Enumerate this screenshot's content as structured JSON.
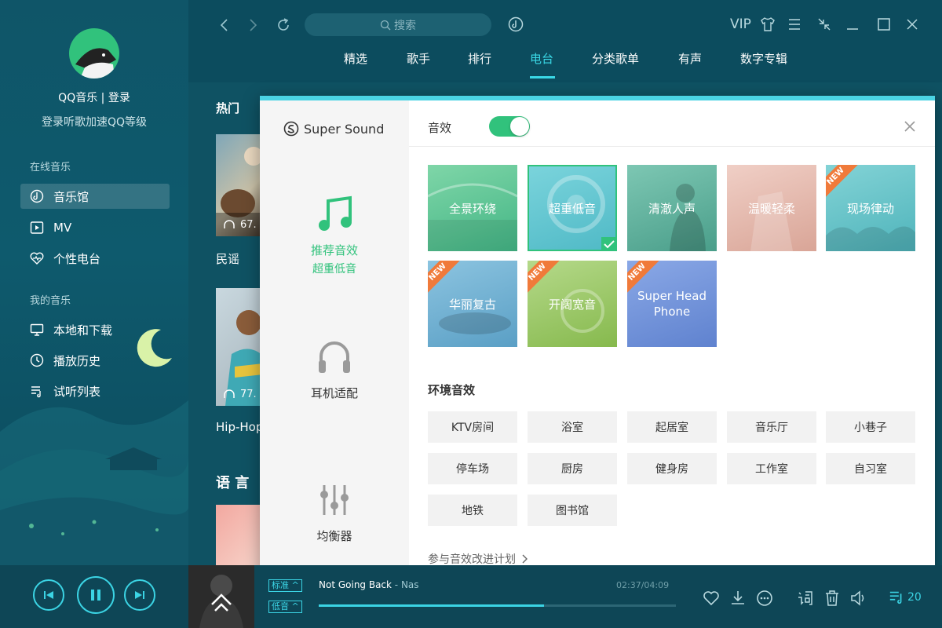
{
  "sidebar": {
    "login_text": "QQ音乐 | 登录",
    "login_hint": "登录听歌加速QQ等级",
    "online_section": "在线音乐",
    "online_items": [
      "音乐馆",
      "MV",
      "个性电台"
    ],
    "my_section": "我的音乐",
    "my_items": [
      "本地和下载",
      "播放历史",
      "试听列表"
    ]
  },
  "topbar": {
    "search_placeholder": "搜索",
    "vip_label": "VIP",
    "tabs": [
      "精选",
      "歌手",
      "排行",
      "电台",
      "分类歌单",
      "有声",
      "数字专辑"
    ],
    "active_tab": "电台"
  },
  "background": {
    "hot_label": "热门",
    "card1_count": "67.",
    "card1_title": "民谣",
    "card2_count": "77.",
    "card2_title": "Hip-Hop",
    "lang_label": "语 言"
  },
  "dialog": {
    "brand": "Super Sound",
    "effect_label": "音效",
    "effect_on": true,
    "side": {
      "recommend_title": "推荐音效",
      "recommend_sub": "超重低音",
      "headphone": "耳机适配",
      "equalizer": "均衡器"
    },
    "tiles": [
      {
        "label": "全景环绕",
        "color": "#4cbd8a",
        "new": false,
        "selected": false
      },
      {
        "label": "超重低音",
        "color": "#58c4cf",
        "new": false,
        "selected": true
      },
      {
        "label": "清澈人声",
        "color": "#5fb49f",
        "new": false,
        "selected": false
      },
      {
        "label": "温暖轻柔",
        "color": "#e7b8ad",
        "new": false,
        "selected": false
      },
      {
        "label": "现场律动",
        "color": "#5ac2c7",
        "new": true,
        "selected": false
      },
      {
        "label": "华丽复古",
        "color": "#6aaed0",
        "new": true,
        "selected": false
      },
      {
        "label": "开阔宽音",
        "color": "#97c45a",
        "new": true,
        "selected": false
      },
      {
        "label": "Super Head Phone",
        "color": "#6b8fd6",
        "new": true,
        "selected": false
      }
    ],
    "new_badge": "NEW",
    "env_title": "环境音效",
    "env_items": [
      "KTV房间",
      "浴室",
      "起居室",
      "音乐厅",
      "小巷子",
      "停车场",
      "厨房",
      "健身房",
      "工作室",
      "自习室",
      "地铁",
      "图书馆"
    ],
    "plan_link": "参与音效改进计划"
  },
  "player": {
    "song": "Not Going Back",
    "artist": "Nas",
    "separator": " - ",
    "quality1": "标准",
    "quality2": "低音",
    "time_current": "02:37",
    "time_total": "04:09",
    "time_sep": "/",
    "progress": 0.63,
    "playlist_count": "20"
  },
  "colors": {
    "accent": "#31c27c",
    "cyan": "#3bd4e4"
  }
}
